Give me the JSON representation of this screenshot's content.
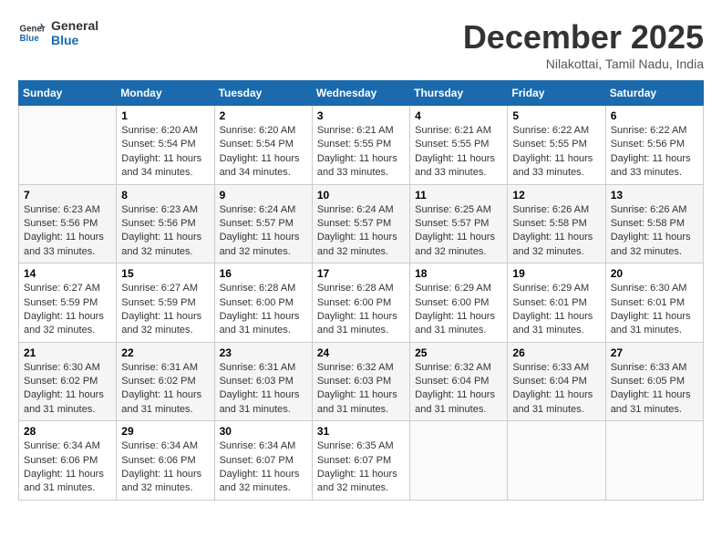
{
  "header": {
    "logo_line1": "General",
    "logo_line2": "Blue",
    "month_title": "December 2025",
    "location": "Nilakottai, Tamil Nadu, India"
  },
  "columns": [
    "Sunday",
    "Monday",
    "Tuesday",
    "Wednesday",
    "Thursday",
    "Friday",
    "Saturday"
  ],
  "weeks": [
    [
      {
        "day": "",
        "info": ""
      },
      {
        "day": "1",
        "info": "Sunrise: 6:20 AM\nSunset: 5:54 PM\nDaylight: 11 hours\nand 34 minutes."
      },
      {
        "day": "2",
        "info": "Sunrise: 6:20 AM\nSunset: 5:54 PM\nDaylight: 11 hours\nand 34 minutes."
      },
      {
        "day": "3",
        "info": "Sunrise: 6:21 AM\nSunset: 5:55 PM\nDaylight: 11 hours\nand 33 minutes."
      },
      {
        "day": "4",
        "info": "Sunrise: 6:21 AM\nSunset: 5:55 PM\nDaylight: 11 hours\nand 33 minutes."
      },
      {
        "day": "5",
        "info": "Sunrise: 6:22 AM\nSunset: 5:55 PM\nDaylight: 11 hours\nand 33 minutes."
      },
      {
        "day": "6",
        "info": "Sunrise: 6:22 AM\nSunset: 5:56 PM\nDaylight: 11 hours\nand 33 minutes."
      }
    ],
    [
      {
        "day": "7",
        "info": "Sunrise: 6:23 AM\nSunset: 5:56 PM\nDaylight: 11 hours\nand 33 minutes."
      },
      {
        "day": "8",
        "info": "Sunrise: 6:23 AM\nSunset: 5:56 PM\nDaylight: 11 hours\nand 32 minutes."
      },
      {
        "day": "9",
        "info": "Sunrise: 6:24 AM\nSunset: 5:57 PM\nDaylight: 11 hours\nand 32 minutes."
      },
      {
        "day": "10",
        "info": "Sunrise: 6:24 AM\nSunset: 5:57 PM\nDaylight: 11 hours\nand 32 minutes."
      },
      {
        "day": "11",
        "info": "Sunrise: 6:25 AM\nSunset: 5:57 PM\nDaylight: 11 hours\nand 32 minutes."
      },
      {
        "day": "12",
        "info": "Sunrise: 6:26 AM\nSunset: 5:58 PM\nDaylight: 11 hours\nand 32 minutes."
      },
      {
        "day": "13",
        "info": "Sunrise: 6:26 AM\nSunset: 5:58 PM\nDaylight: 11 hours\nand 32 minutes."
      }
    ],
    [
      {
        "day": "14",
        "info": "Sunrise: 6:27 AM\nSunset: 5:59 PM\nDaylight: 11 hours\nand 32 minutes."
      },
      {
        "day": "15",
        "info": "Sunrise: 6:27 AM\nSunset: 5:59 PM\nDaylight: 11 hours\nand 32 minutes."
      },
      {
        "day": "16",
        "info": "Sunrise: 6:28 AM\nSunset: 6:00 PM\nDaylight: 11 hours\nand 31 minutes."
      },
      {
        "day": "17",
        "info": "Sunrise: 6:28 AM\nSunset: 6:00 PM\nDaylight: 11 hours\nand 31 minutes."
      },
      {
        "day": "18",
        "info": "Sunrise: 6:29 AM\nSunset: 6:00 PM\nDaylight: 11 hours\nand 31 minutes."
      },
      {
        "day": "19",
        "info": "Sunrise: 6:29 AM\nSunset: 6:01 PM\nDaylight: 11 hours\nand 31 minutes."
      },
      {
        "day": "20",
        "info": "Sunrise: 6:30 AM\nSunset: 6:01 PM\nDaylight: 11 hours\nand 31 minutes."
      }
    ],
    [
      {
        "day": "21",
        "info": "Sunrise: 6:30 AM\nSunset: 6:02 PM\nDaylight: 11 hours\nand 31 minutes."
      },
      {
        "day": "22",
        "info": "Sunrise: 6:31 AM\nSunset: 6:02 PM\nDaylight: 11 hours\nand 31 minutes."
      },
      {
        "day": "23",
        "info": "Sunrise: 6:31 AM\nSunset: 6:03 PM\nDaylight: 11 hours\nand 31 minutes."
      },
      {
        "day": "24",
        "info": "Sunrise: 6:32 AM\nSunset: 6:03 PM\nDaylight: 11 hours\nand 31 minutes."
      },
      {
        "day": "25",
        "info": "Sunrise: 6:32 AM\nSunset: 6:04 PM\nDaylight: 11 hours\nand 31 minutes."
      },
      {
        "day": "26",
        "info": "Sunrise: 6:33 AM\nSunset: 6:04 PM\nDaylight: 11 hours\nand 31 minutes."
      },
      {
        "day": "27",
        "info": "Sunrise: 6:33 AM\nSunset: 6:05 PM\nDaylight: 11 hours\nand 31 minutes."
      }
    ],
    [
      {
        "day": "28",
        "info": "Sunrise: 6:34 AM\nSunset: 6:06 PM\nDaylight: 11 hours\nand 31 minutes."
      },
      {
        "day": "29",
        "info": "Sunrise: 6:34 AM\nSunset: 6:06 PM\nDaylight: 11 hours\nand 32 minutes."
      },
      {
        "day": "30",
        "info": "Sunrise: 6:34 AM\nSunset: 6:07 PM\nDaylight: 11 hours\nand 32 minutes."
      },
      {
        "day": "31",
        "info": "Sunrise: 6:35 AM\nSunset: 6:07 PM\nDaylight: 11 hours\nand 32 minutes."
      },
      {
        "day": "",
        "info": ""
      },
      {
        "day": "",
        "info": ""
      },
      {
        "day": "",
        "info": ""
      }
    ]
  ]
}
